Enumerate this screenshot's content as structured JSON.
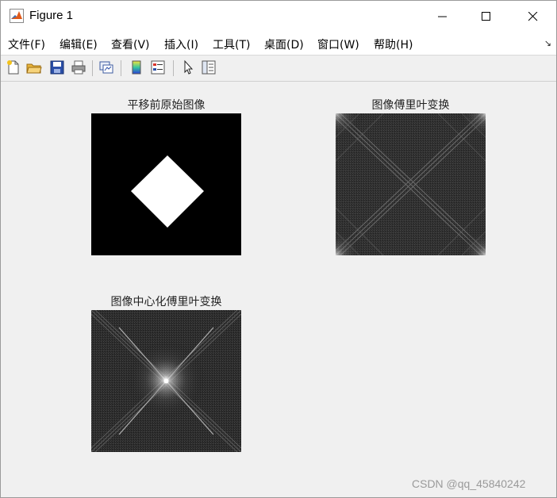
{
  "window": {
    "title": "Figure 1"
  },
  "menubar": {
    "items": [
      {
        "label": "文件(F)"
      },
      {
        "label": "编辑(E)"
      },
      {
        "label": "查看(V)"
      },
      {
        "label": "插入(I)"
      },
      {
        "label": "工具(T)"
      },
      {
        "label": "桌面(D)"
      },
      {
        "label": "窗口(W)"
      },
      {
        "label": "帮助(H)"
      }
    ]
  },
  "toolbar": {
    "icons": [
      "new-figure-icon",
      "open-file-icon",
      "save-icon",
      "print-icon",
      "link-plot-icon",
      "colorbar-icon",
      "legend-icon",
      "pointer-icon",
      "property-inspector-icon"
    ]
  },
  "subplots": [
    {
      "title": "平移前原始图像"
    },
    {
      "title": "图像傅里叶变换"
    },
    {
      "title": "图像中心化傅里叶变换"
    }
  ],
  "watermark": "CSDN @qq_45840242",
  "colors": {
    "window_bg": "#f0f0f0",
    "titlebar_bg": "#ffffff",
    "image_black": "#000000",
    "image_white": "#ffffff"
  }
}
